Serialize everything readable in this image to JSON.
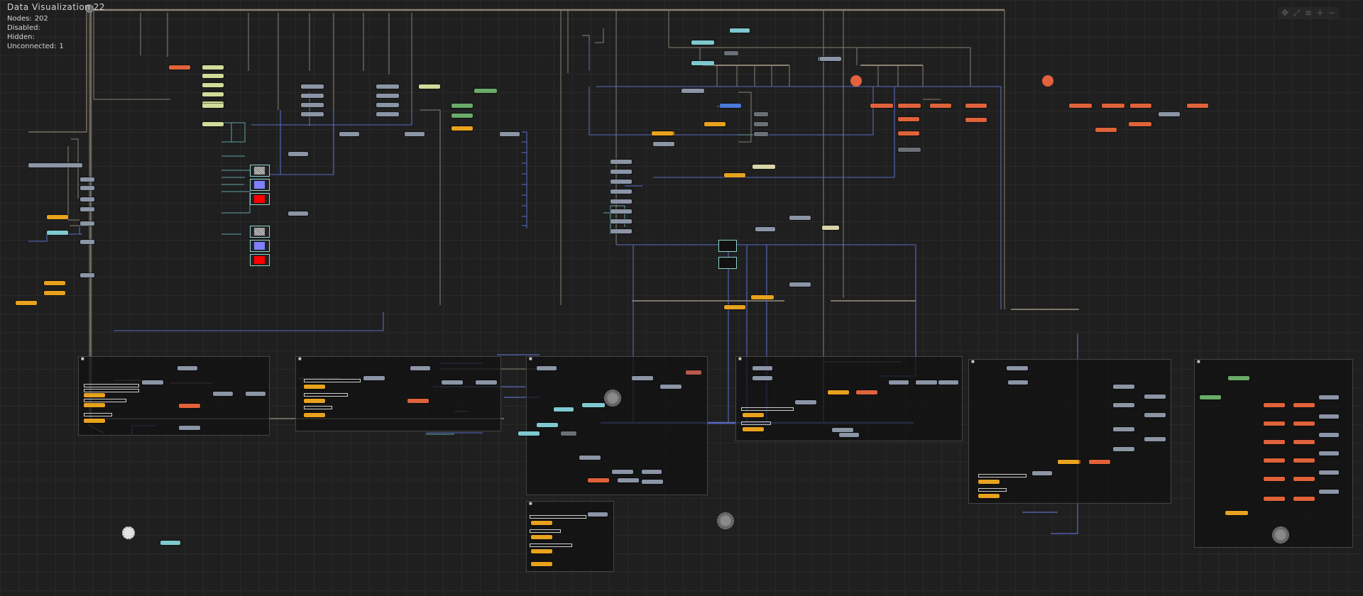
{
  "app": {
    "title": "Data Visualization 22"
  },
  "stats": [
    {
      "label": "Nodes:",
      "value": "202"
    },
    {
      "label": "Disabled:",
      "value": ""
    },
    {
      "label": "Hidden:",
      "value": ""
    },
    {
      "label": "Unconnected:",
      "value": "1"
    }
  ],
  "toolbar": [
    {
      "name": "fit-view-icon",
      "glyph": "✥"
    },
    {
      "name": "fullscreen-icon",
      "glyph": "⤢"
    },
    {
      "name": "align-icon",
      "glyph": "≡"
    },
    {
      "name": "zoom-in-icon",
      "glyph": "+"
    },
    {
      "name": "zoom-out-icon",
      "glyph": "−"
    }
  ],
  "colors": {
    "background": "#1f1f1f",
    "wire_beige": "#8a8270",
    "wire_blue": "#5a6bc4",
    "wire_teal": "#5fa3a0",
    "node_gray": "#8b95a6",
    "node_yellow": "#e8a21e",
    "node_orange": "#e0623a",
    "node_teal": "#7ec9cf"
  }
}
